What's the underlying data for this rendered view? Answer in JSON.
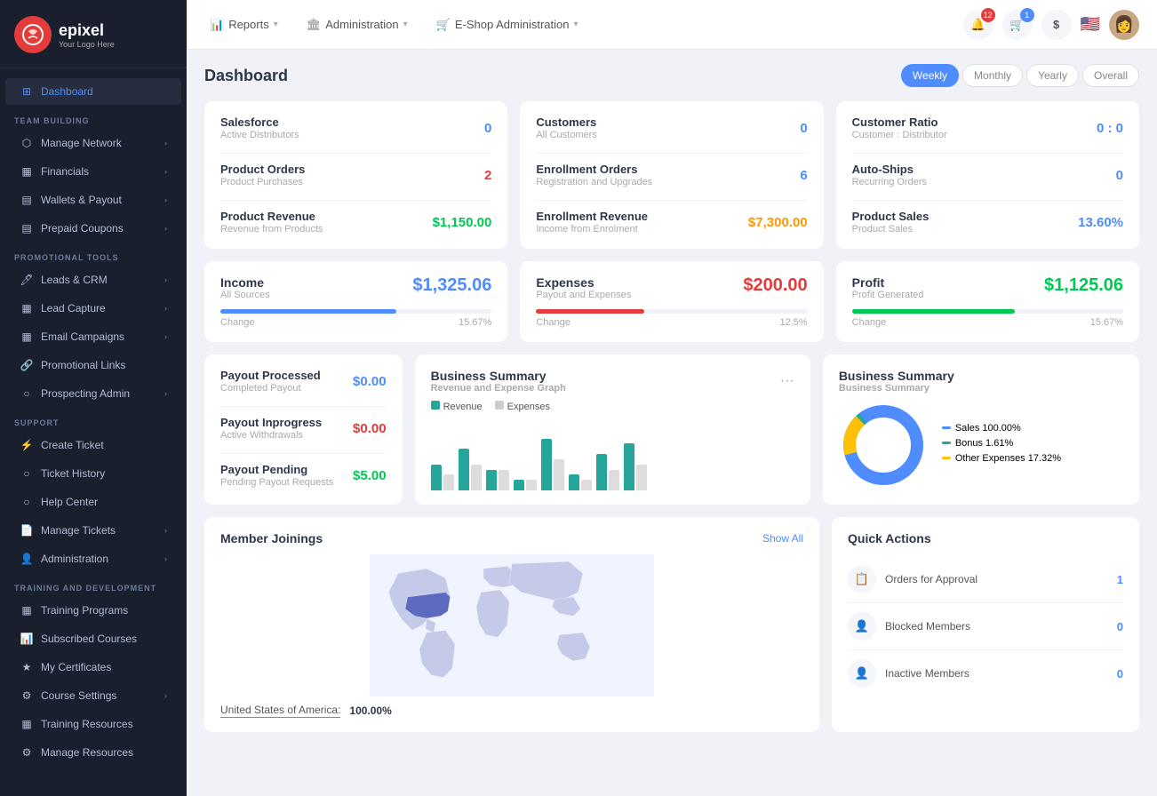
{
  "sidebar": {
    "logo": {
      "brand": "epixel",
      "tagline": "Your Logo Here"
    },
    "sections": [
      {
        "label": "TEAM BUILDING",
        "items": [
          {
            "id": "manage-network",
            "label": "Manage Network",
            "hasChevron": true
          },
          {
            "id": "financials",
            "label": "Financials",
            "hasChevron": true
          },
          {
            "id": "wallets-payout",
            "label": "Wallets & Payout",
            "hasChevron": true
          },
          {
            "id": "prepaid-coupons",
            "label": "Prepaid Coupons",
            "hasChevron": true
          }
        ]
      },
      {
        "label": "PROMOTIONAL TOOLS",
        "items": [
          {
            "id": "leads-crm",
            "label": "Leads & CRM",
            "hasChevron": true
          },
          {
            "id": "lead-capture",
            "label": "Lead Capture",
            "hasChevron": true
          },
          {
            "id": "email-campaigns",
            "label": "Email Campaigns",
            "hasChevron": true
          },
          {
            "id": "promotional-links",
            "label": "Promotional Links",
            "hasChevron": false
          },
          {
            "id": "prospecting-admin",
            "label": "Prospecting Admin",
            "hasChevron": true
          }
        ]
      },
      {
        "label": "SUPPORT",
        "items": [
          {
            "id": "create-ticket",
            "label": "Create Ticket",
            "hasChevron": false
          },
          {
            "id": "ticket-history",
            "label": "Ticket History",
            "hasChevron": false
          },
          {
            "id": "help-center",
            "label": "Help Center",
            "hasChevron": false
          },
          {
            "id": "manage-tickets",
            "label": "Manage Tickets",
            "hasChevron": true
          },
          {
            "id": "administration",
            "label": "Administration",
            "hasChevron": true
          }
        ]
      },
      {
        "label": "TRAINING AND DEVELOPMENT",
        "items": [
          {
            "id": "training-programs",
            "label": "Training Programs",
            "hasChevron": false
          },
          {
            "id": "subscribed-courses",
            "label": "Subscribed Courses",
            "hasChevron": false
          },
          {
            "id": "my-certificates",
            "label": "My Certificates",
            "hasChevron": false
          },
          {
            "id": "course-settings",
            "label": "Course Settings",
            "hasChevron": true
          },
          {
            "id": "training-resources",
            "label": "Training Resources",
            "hasChevron": false
          },
          {
            "id": "manage-resources",
            "label": "Manage Resources",
            "hasChevron": false
          }
        ]
      }
    ],
    "active": "dashboard"
  },
  "topnav": {
    "items": [
      {
        "id": "reports",
        "label": "Reports",
        "icon": "📊"
      },
      {
        "id": "administration",
        "label": "Administration",
        "icon": "🏛️"
      },
      {
        "id": "eshop",
        "label": "E-Shop Administration",
        "icon": "🛒"
      }
    ],
    "notifications": {
      "bell_count": "12",
      "cart_count": "1"
    }
  },
  "dashboard": {
    "title": "Dashboard",
    "periods": [
      "Weekly",
      "Monthly",
      "Yearly",
      "Overall"
    ],
    "active_period": "Weekly",
    "stats_col1": {
      "salesforce": {
        "label": "Salesforce",
        "sub": "Active Distributors",
        "value": "0",
        "color": "blue"
      },
      "product_orders": {
        "label": "Product Orders",
        "sub": "Product Purchases",
        "value": "2",
        "color": "red"
      },
      "product_revenue": {
        "label": "Product Revenue",
        "sub": "Revenue from Products",
        "value": "$1,150.00",
        "color": "green"
      }
    },
    "stats_col2": {
      "customers": {
        "label": "Customers",
        "sub": "All Customers",
        "value": "0",
        "color": "blue"
      },
      "enrollment_orders": {
        "label": "Enrollment Orders",
        "sub": "Registration and Upgrades",
        "value": "6",
        "color": "blue"
      },
      "enrollment_revenue": {
        "label": "Enrollment Revenue",
        "sub": "Income from Enrolment",
        "value": "$7,300.00",
        "color": "orange"
      }
    },
    "stats_col3": {
      "customer_ratio": {
        "label": "Customer Ratio",
        "sub": "Customer : Distributor",
        "value": "0 : 0",
        "color": "mixed"
      },
      "auto_ships": {
        "label": "Auto-Ships",
        "sub": "Recurring Orders",
        "value": "0",
        "color": "blue"
      },
      "product_sales": {
        "label": "Product Sales",
        "sub": "Product Sales",
        "value": "13.60%",
        "color": "blue"
      }
    },
    "income": {
      "title": "Income",
      "sub": "All Sources",
      "value": "$1,325.06",
      "progress": 65,
      "change_label": "Change",
      "change_value": "15.67%"
    },
    "expenses": {
      "title": "Expenses",
      "sub": "Payout and Expenses",
      "value": "$200.00",
      "progress": 40,
      "change_label": "Change",
      "change_value": "12.5%"
    },
    "profit": {
      "title": "Profit",
      "sub": "Profit Generated",
      "value": "$1,125.06",
      "progress": 60,
      "change_label": "Change",
      "change_value": "15.67%"
    },
    "payout": {
      "processed": {
        "label": "Payout Processed",
        "sub": "Completed Payout",
        "value": "$0.00"
      },
      "inprogress": {
        "label": "Payout Inprogress",
        "sub": "Active Withdrawals",
        "value": "$0.00"
      },
      "pending": {
        "label": "Payout Pending",
        "sub": "Pending Payout Requests",
        "value": "$5.00"
      }
    },
    "business_summary_graph": {
      "title": "Business Summary",
      "sub": "Revenue and Expense Graph",
      "legend": {
        "revenue": "Revenue",
        "expenses": "Expenses"
      },
      "bars": [
        {
          "rev": 5,
          "exp": 3
        },
        {
          "rev": 8,
          "exp": 5
        },
        {
          "rev": 4,
          "exp": 4
        },
        {
          "rev": 2,
          "exp": 2
        },
        {
          "rev": 10,
          "exp": 6
        },
        {
          "rev": 3,
          "exp": 2
        },
        {
          "rev": 7,
          "exp": 4
        },
        {
          "rev": 9,
          "exp": 5
        }
      ]
    },
    "business_summary_donut": {
      "title": "Business Summary",
      "sub": "Business Summary",
      "legend": [
        {
          "id": "sales",
          "label": "Sales 100.00%",
          "color": "blue"
        },
        {
          "id": "bonus",
          "label": "Bonus 1.61%",
          "color": "green"
        },
        {
          "id": "other",
          "label": "Other Expenses 17.32%",
          "color": "yellow"
        }
      ]
    },
    "member_joinings": {
      "title": "Member Joinings",
      "show_all": "Show All",
      "country": "United States of America:",
      "pct": "100.00%"
    },
    "quick_actions": {
      "title": "Quick Actions",
      "items": [
        {
          "id": "orders-approval",
          "label": "Orders for Approval",
          "count": "1"
        },
        {
          "id": "blocked-members",
          "label": "Blocked Members",
          "count": "0"
        },
        {
          "id": "inactive-members",
          "label": "Inactive Members",
          "count": "0"
        }
      ]
    }
  }
}
